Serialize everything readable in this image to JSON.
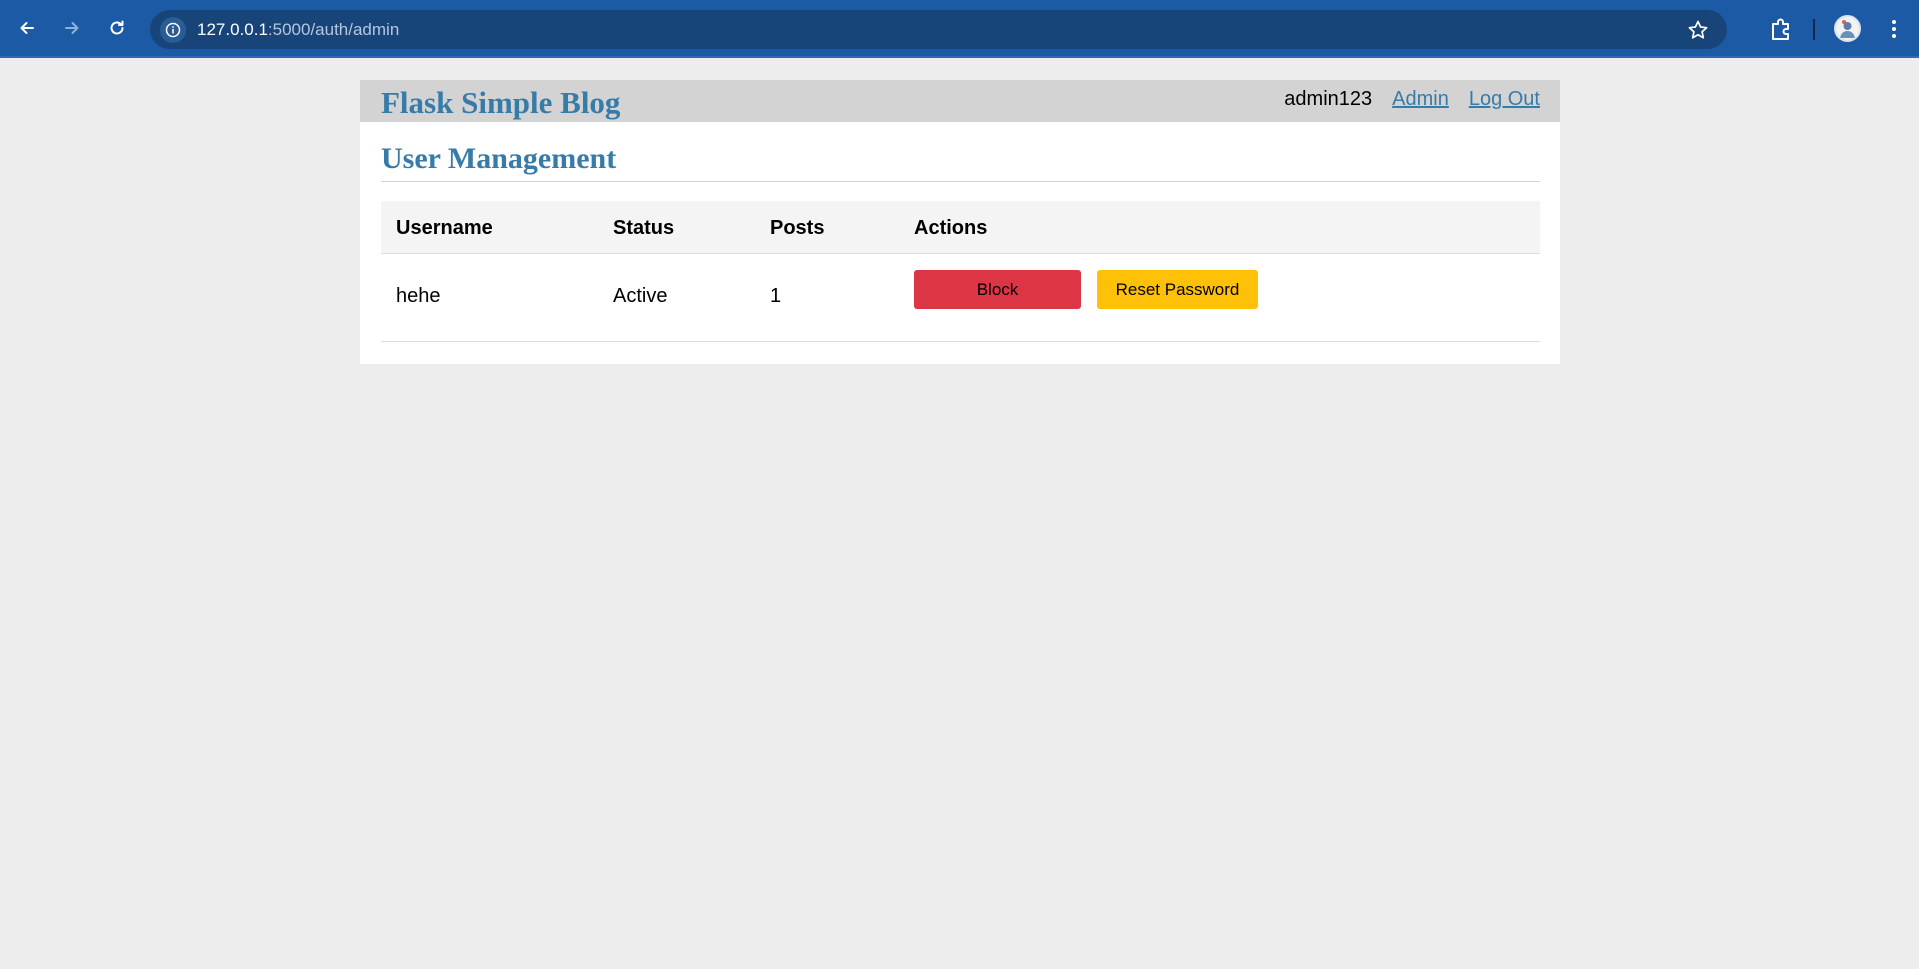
{
  "browser": {
    "url_host": "127.0.0.1",
    "url_path": ":5000/auth/admin",
    "icons": [
      "back-arrow-icon",
      "forward-arrow-icon",
      "reload-icon",
      "site-info-icon",
      "bookmark-star-icon",
      "extensions-puzzle-icon",
      "profile-avatar",
      "kebab-menu-icon"
    ],
    "theme_color": "#1c5aa6"
  },
  "header": {
    "site_title": "Flask Simple Blog",
    "username": "admin123",
    "admin_link": "Admin",
    "logout_link": "Log Out"
  },
  "main": {
    "heading": "User Management",
    "table": {
      "columns": [
        "Username",
        "Status",
        "Posts",
        "Actions"
      ],
      "rows": [
        {
          "username": "hehe",
          "status": "Active",
          "posts": "1",
          "block_label": "Block",
          "reset_label": "Reset Password"
        }
      ]
    }
  },
  "colors": {
    "accent": "#377ba8",
    "block_button": "#dc3545",
    "reset_button": "#ffc107",
    "header_bg": "#d3d3d3",
    "page_bg": "#ededed"
  }
}
